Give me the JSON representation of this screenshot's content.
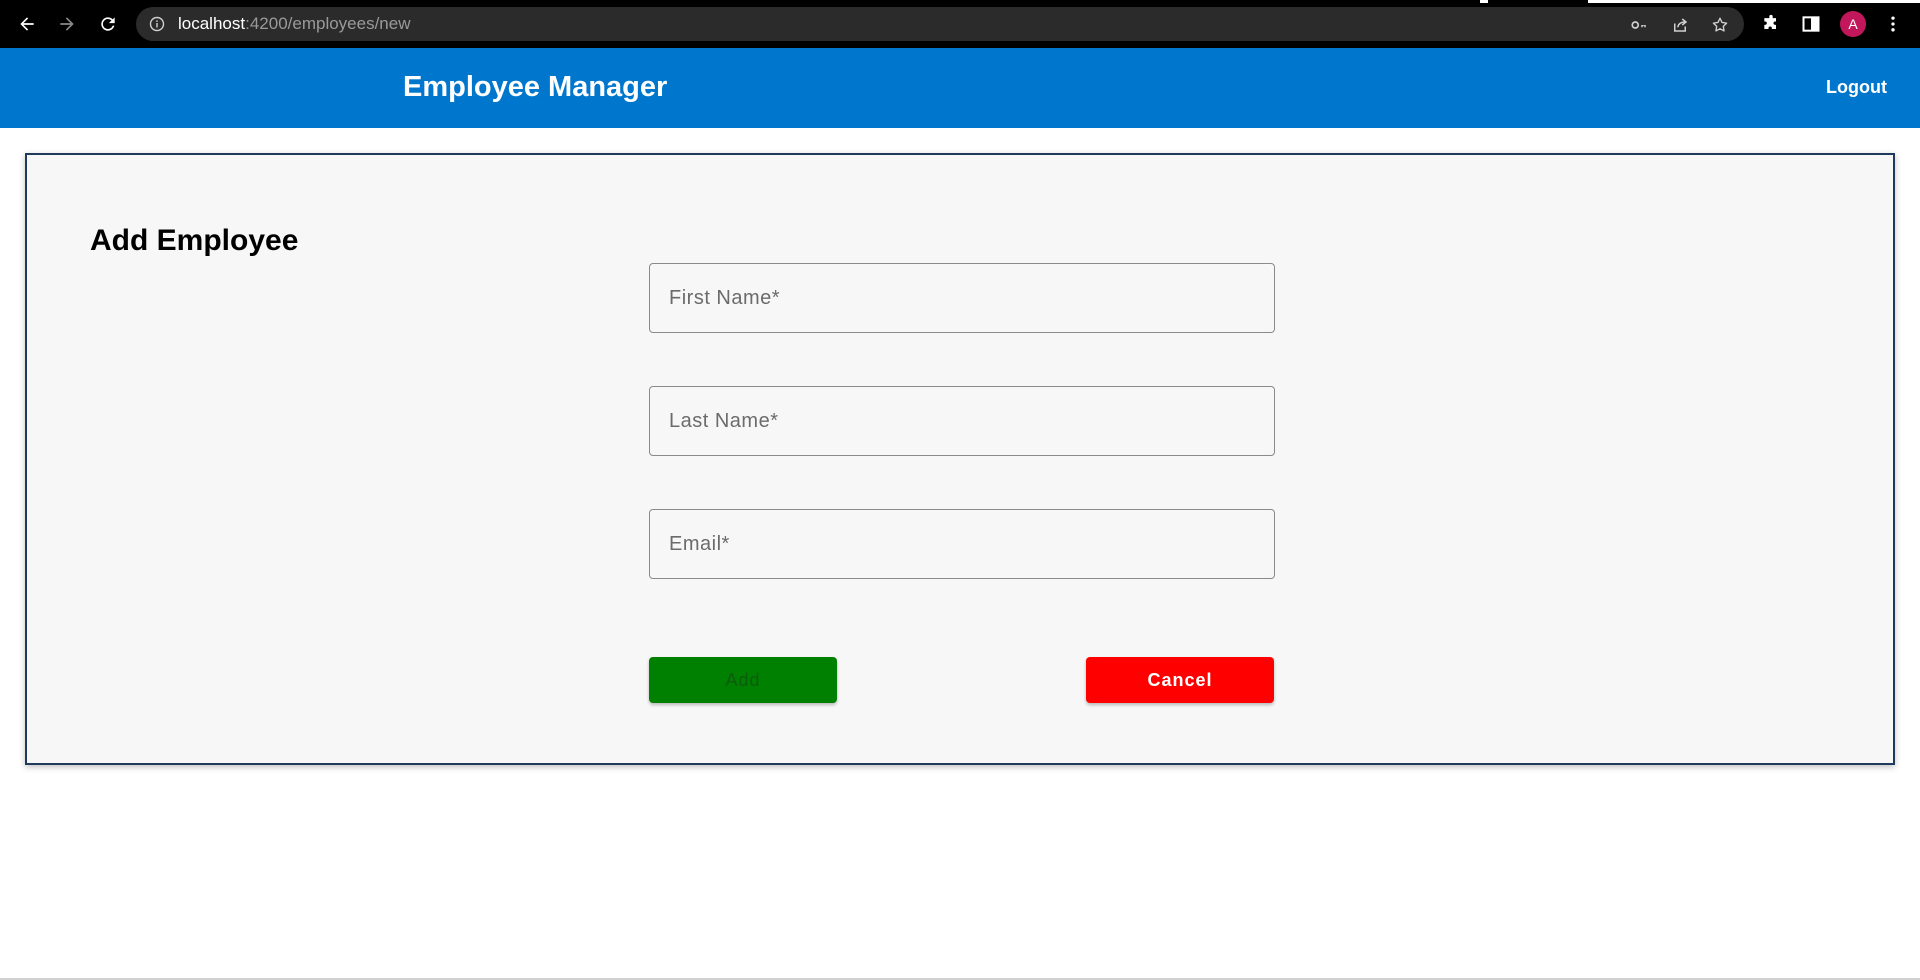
{
  "browser": {
    "url_host": "localhost",
    "url_path": ":4200/employees/new",
    "profile_initial": "A",
    "icons": [
      "back-icon",
      "forward-icon",
      "reload-icon",
      "info-icon",
      "key-icon",
      "share-icon",
      "star-icon",
      "extensions-icon",
      "side-panel-icon",
      "menu-icon"
    ],
    "colors": {
      "chrome": "#000000",
      "omnibox": "#2b2b2b",
      "avatar": "#c2185b"
    }
  },
  "header": {
    "title": "Employee Manager",
    "logout_label": "Logout",
    "color": "#0077cc"
  },
  "form": {
    "heading": "Add Employee",
    "fields": {
      "first_name": {
        "placeholder": "First Name*",
        "value": ""
      },
      "last_name": {
        "placeholder": "Last Name*",
        "value": ""
      },
      "email": {
        "placeholder": "Email*",
        "value": ""
      }
    },
    "add_label": "Add",
    "cancel_label": "Cancel",
    "colors": {
      "add": "#008000",
      "cancel": "#ff0000",
      "card_border": "#1f3a5a"
    }
  }
}
